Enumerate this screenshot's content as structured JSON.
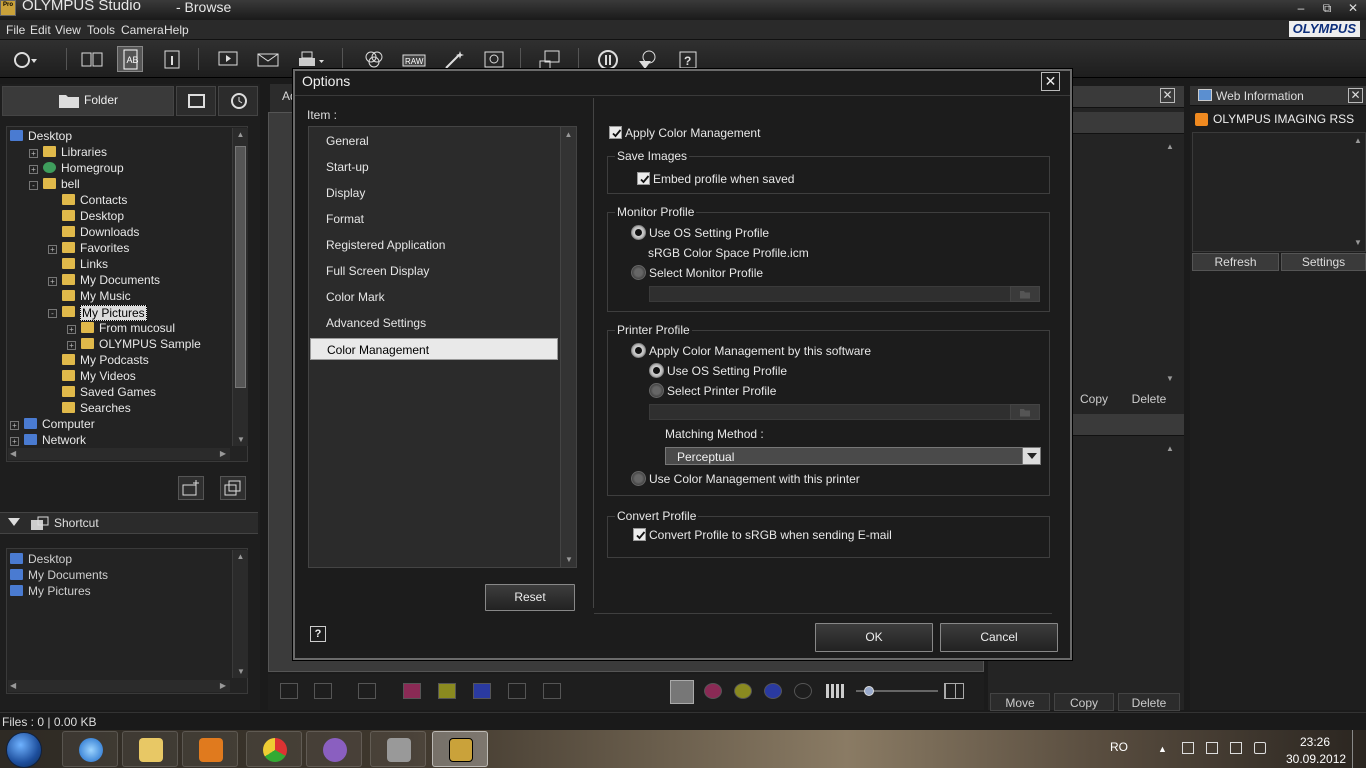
{
  "window": {
    "app_title": "OLYMPUS Studio",
    "subtitle": "- Browse",
    "logo_text": "Pro"
  },
  "menu": {
    "file": "File",
    "edit": "Edit",
    "view": "View",
    "tools": "Tools",
    "camera": "Camera",
    "help": "Help"
  },
  "brand": "OLYMPUS",
  "left_panel": {
    "folder_tab": "Folder",
    "tree": [
      {
        "label": "Desktop",
        "depth": 0,
        "expander": "",
        "icon": "desktop"
      },
      {
        "label": "Libraries",
        "depth": 1,
        "expander": "+",
        "icon": "folder"
      },
      {
        "label": "Homegroup",
        "depth": 1,
        "expander": "+",
        "icon": "globe"
      },
      {
        "label": "bell",
        "depth": 1,
        "expander": "-",
        "icon": "folder"
      },
      {
        "label": "Contacts",
        "depth": 2,
        "expander": "",
        "icon": "folder"
      },
      {
        "label": "Desktop",
        "depth": 2,
        "expander": "",
        "icon": "folder"
      },
      {
        "label": "Downloads",
        "depth": 2,
        "expander": "",
        "icon": "folder"
      },
      {
        "label": "Favorites",
        "depth": 2,
        "expander": "+",
        "icon": "folder"
      },
      {
        "label": "Links",
        "depth": 2,
        "expander": "",
        "icon": "folder"
      },
      {
        "label": "My Documents",
        "depth": 2,
        "expander": "+",
        "icon": "folder"
      },
      {
        "label": "My Music",
        "depth": 2,
        "expander": "",
        "icon": "folder"
      },
      {
        "label": "My Pictures",
        "depth": 2,
        "expander": "-",
        "icon": "folder",
        "selected": true
      },
      {
        "label": "From mucosul",
        "depth": 3,
        "expander": "+",
        "icon": "folder"
      },
      {
        "label": "OLYMPUS Sample",
        "depth": 3,
        "expander": "+",
        "icon": "folder"
      },
      {
        "label": "My Podcasts",
        "depth": 2,
        "expander": "",
        "icon": "folder"
      },
      {
        "label": "My Videos",
        "depth": 2,
        "expander": "",
        "icon": "folder"
      },
      {
        "label": "Saved Games",
        "depth": 2,
        "expander": "",
        "icon": "folder"
      },
      {
        "label": "Searches",
        "depth": 2,
        "expander": "",
        "icon": "folder"
      },
      {
        "label": "Computer",
        "depth": 0,
        "expander": "+",
        "icon": "desktop"
      },
      {
        "label": "Network",
        "depth": 0,
        "expander": "+",
        "icon": "desktop"
      }
    ],
    "shortcut_title": "Shortcut",
    "shortcuts": [
      "Desktop",
      "My Documents",
      "My Pictures"
    ]
  },
  "center": {
    "tab_label": "Ad"
  },
  "mid_right": {
    "copy": "Copy",
    "delete": "Delete",
    "move": "Move",
    "copy2": "Copy",
    "delete2": "Delete"
  },
  "web_info": {
    "title": "Web Information",
    "rss": "OLYMPUS IMAGING RSS",
    "refresh": "Refresh",
    "settings": "Settings"
  },
  "status": {
    "files": "Files : 0",
    "size": "0.00 KB"
  },
  "taskbar": {
    "lang": "RO",
    "time": "23:26",
    "date": "30.09.2012"
  },
  "dialog": {
    "title": "Options",
    "item_label": "Item :",
    "items": [
      {
        "label": "General"
      },
      {
        "label": "Start-up"
      },
      {
        "label": "Display"
      },
      {
        "label": "Format"
      },
      {
        "label": "Registered Application"
      },
      {
        "label": "Full Screen Display"
      },
      {
        "label": "Color Mark"
      },
      {
        "label": "Advanced Settings"
      },
      {
        "label": "Color Management",
        "selected": true
      }
    ],
    "reset": "Reset",
    "ok": "OK",
    "cancel": "Cancel",
    "apply_cm": {
      "label": "Apply Color Management",
      "checked": true
    },
    "save_images": {
      "title": "Save Images",
      "embed_label": "Embed profile when saved",
      "embed_checked": true
    },
    "monitor_profile": {
      "title": "Monitor Profile",
      "use_os": "Use OS Setting Profile",
      "profile_name": "sRGB Color Space Profile.icm",
      "select": "Select Monitor Profile",
      "selected": "use_os"
    },
    "printer_profile": {
      "title": "Printer Profile",
      "apply_sw": "Apply Color Management by this software",
      "use_os": "Use OS Setting Profile",
      "select": "Select Printer Profile",
      "matching_label": "Matching Method :",
      "matching_value": "Perceptual",
      "use_printer": "Use Color Management with this printer",
      "selected": "apply_sw",
      "sub_selected": "use_os"
    },
    "convert_profile": {
      "title": "Convert Profile",
      "label": "Convert Profile to sRGB when sending E-mail",
      "checked": true
    }
  },
  "colors": {
    "dialog_bg": "#1c1c1c",
    "list_bg": "#2b2b2b",
    "selection_bg": "#e9e9e9",
    "brand_blue": "#0b2d7a"
  }
}
